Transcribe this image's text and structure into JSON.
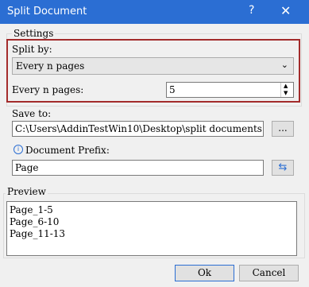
{
  "window": {
    "title": "Split Document",
    "help": "?",
    "close": "✕"
  },
  "settings": {
    "group_label": "Settings",
    "split_by_label": "Split by:",
    "split_by_value": "Every n pages",
    "every_n_label": "Every n pages:",
    "every_n_value": "5"
  },
  "save": {
    "label": "Save to:",
    "path": "C:\\Users\\AddinTestWin10\\Desktop\\split documents",
    "browse": "..."
  },
  "prefix": {
    "label": "Document Prefix:",
    "value": "Page",
    "icon": "refresh-icon"
  },
  "preview": {
    "label": "Preview",
    "lines": [
      "Page_1-5",
      "Page_6-10",
      "Page_11-13"
    ]
  },
  "footer": {
    "ok": "Ok",
    "cancel": "Cancel"
  }
}
